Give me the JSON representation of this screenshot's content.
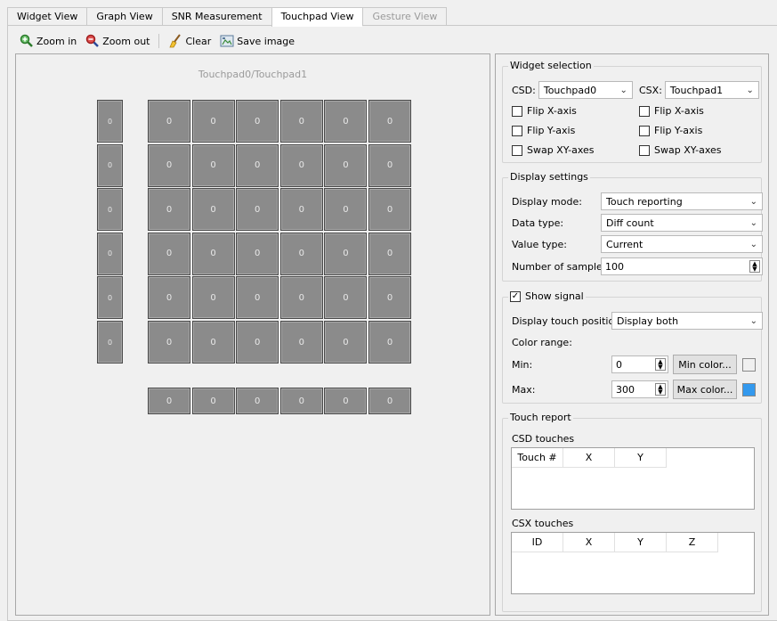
{
  "tabs": [
    "Widget View",
    "Graph View",
    "SNR Measurement",
    "Touchpad View",
    "Gesture View"
  ],
  "active_tab": "Touchpad View",
  "toolbar": {
    "zoom_in": "Zoom in",
    "zoom_out": "Zoom out",
    "clear": "Clear",
    "save_image": "Save image"
  },
  "canvas": {
    "title": "Touchpad0/Touchpad1",
    "row_values": [
      "0",
      "0",
      "0",
      "0",
      "0",
      "0"
    ],
    "grid": [
      [
        "0",
        "0",
        "0",
        "0",
        "0",
        "0"
      ],
      [
        "0",
        "0",
        "0",
        "0",
        "0",
        "0"
      ],
      [
        "0",
        "0",
        "0",
        "0",
        "0",
        "0"
      ],
      [
        "0",
        "0",
        "0",
        "0",
        "0",
        "0"
      ],
      [
        "0",
        "0",
        "0",
        "0",
        "0",
        "0"
      ],
      [
        "0",
        "0",
        "0",
        "0",
        "0",
        "0"
      ]
    ],
    "column_values": [
      "0",
      "0",
      "0",
      "0",
      "0",
      "0"
    ]
  },
  "widget_selection": {
    "title": "Widget selection",
    "csd_label": "CSD:",
    "csd_value": "Touchpad0",
    "csx_label": "CSX:",
    "csx_value": "Touchpad1",
    "flip_x": "Flip X-axis",
    "flip_y": "Flip Y-axis",
    "swap_xy": "Swap XY-axes"
  },
  "display_settings": {
    "title": "Display settings",
    "display_mode_label": "Display mode:",
    "display_mode_value": "Touch reporting",
    "data_type_label": "Data type:",
    "data_type_value": "Diff count",
    "value_type_label": "Value type:",
    "value_type_value": "Current",
    "samples_label": "Number of samples:",
    "samples_value": "100"
  },
  "show_signal": {
    "title": "Show signal",
    "touch_pos_label": "Display touch position:",
    "touch_pos_value": "Display both",
    "color_range_label": "Color range:",
    "min_label": "Min:",
    "min_value": "0",
    "min_color_button": "Min color...",
    "max_label": "Max:",
    "max_value": "300",
    "max_color_button": "Max color...",
    "min_color": "#f0f0f0",
    "max_color": "#3399ee"
  },
  "touch_report": {
    "title": "Touch report",
    "csd_label": "CSD touches",
    "csd_columns": [
      "Touch #",
      "X",
      "Y"
    ],
    "csx_label": "CSX touches",
    "csx_columns": [
      "ID",
      "X",
      "Y",
      "Z"
    ]
  }
}
